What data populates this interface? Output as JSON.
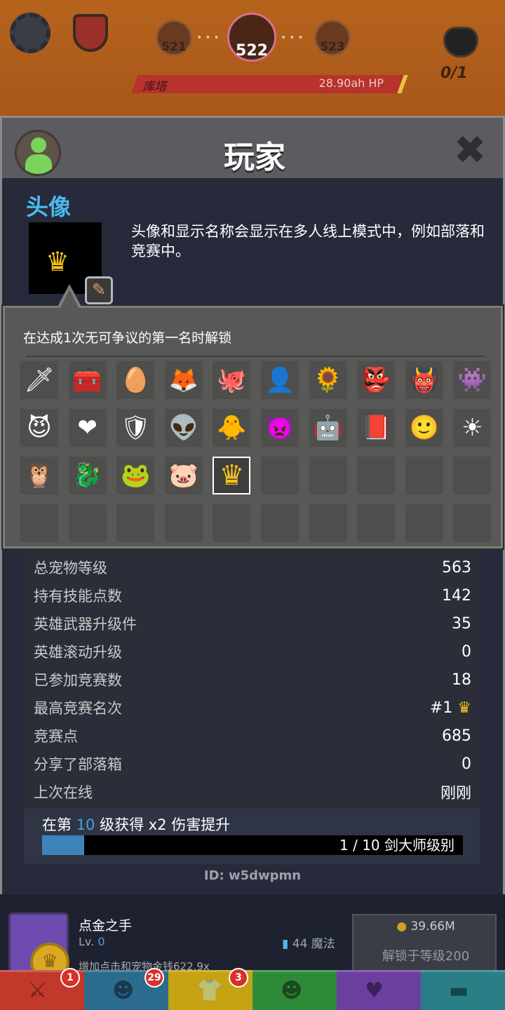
{
  "hud": {
    "stage_prev": "521",
    "stage_current": "522",
    "stage_next": "523",
    "boss_name": "库塔",
    "boss_hp": "28.90ah HP",
    "kills": "0/1"
  },
  "dialog": {
    "title": "玩家",
    "section_label": "头像",
    "description": "头像和显示名称会显示在多人线上模式中，例如部落和竞赛中。",
    "popover_hint": "在达成1次无可争议的第一名时解锁",
    "avatars": [
      {
        "icon": "sword-icon",
        "glyph": "🗡"
      },
      {
        "icon": "treasure-chest-icon",
        "glyph": "🧰"
      },
      {
        "icon": "egg-icon",
        "glyph": "🥚"
      },
      {
        "icon": "fox-icon",
        "glyph": "🦊"
      },
      {
        "icon": "octopus-icon",
        "glyph": "🐙"
      },
      {
        "icon": "blue-spirit-icon",
        "glyph": "👤"
      },
      {
        "icon": "sunflower-icon",
        "glyph": "🌻"
      },
      {
        "icon": "red-mask-icon",
        "glyph": "👺"
      },
      {
        "icon": "red-monster-icon",
        "glyph": "👹"
      },
      {
        "icon": "blue-beast-icon",
        "glyph": "👾"
      },
      {
        "icon": "devil-face-icon",
        "glyph": "😈"
      },
      {
        "icon": "winged-heart-icon",
        "glyph": "❤"
      },
      {
        "icon": "wooden-shield-icon",
        "glyph": "🛡"
      },
      {
        "icon": "green-goblin-icon",
        "glyph": "👽"
      },
      {
        "icon": "chick-icon",
        "glyph": "🐥"
      },
      {
        "icon": "purple-monster-icon",
        "glyph": "👿"
      },
      {
        "icon": "ice-golem-icon",
        "glyph": "🤖"
      },
      {
        "icon": "spellbook-icon",
        "glyph": "📕"
      },
      {
        "icon": "hooded-figure-icon",
        "glyph": "🙂"
      },
      {
        "icon": "red-skull-sun-icon",
        "glyph": "☀"
      },
      {
        "icon": "horned-warrior-icon",
        "glyph": "🦉"
      },
      {
        "icon": "teal-dragon-icon",
        "glyph": "🐉"
      },
      {
        "icon": "green-cat-icon",
        "glyph": "🐸"
      },
      {
        "icon": "pink-fluff-icon",
        "glyph": "🐷"
      },
      {
        "icon": "crown-icon",
        "glyph": "♛"
      }
    ],
    "selected_index": 24,
    "empty_slots": 15
  },
  "stats": [
    {
      "label": "总宠物等级",
      "value": "563"
    },
    {
      "label": "持有技能点数",
      "value": "142"
    },
    {
      "label": "英雄武器升级件",
      "value": "35"
    },
    {
      "label": "英雄滚动升级",
      "value": "0"
    },
    {
      "label": "已参加竞赛数",
      "value": "18"
    },
    {
      "label": "最高竞赛名次",
      "value": "#1"
    },
    {
      "label": "竞赛点",
      "value": "685"
    },
    {
      "label": "分享了部落箱",
      "value": "0"
    },
    {
      "label": "上次在线",
      "value": "刚刚"
    }
  ],
  "progress": {
    "pre": "在第 ",
    "level": "10",
    "post": " 级获得 x2 伤害提升",
    "bar_text": "1 / 10 剑大师级别",
    "fraction": 0.1
  },
  "player_id": "ID: w5dwpmn",
  "background_item": {
    "name": "点金之手",
    "lv_prefix": "Lv. ",
    "lv": "0",
    "mana": "44 魔法",
    "desc": "增加点击和宠物金钱622.9x",
    "cost": "39.66M",
    "unlock": "解锁于等级200"
  },
  "tabs": [
    {
      "name": "tab-sword",
      "badge": "1",
      "color": "#c0392b"
    },
    {
      "name": "tab-heroes",
      "badge": "29",
      "color": "#2b6b8e"
    },
    {
      "name": "tab-equipment",
      "badge": "3",
      "color": "#c5a313"
    },
    {
      "name": "tab-pets",
      "badge": "",
      "color": "#2e8b3a"
    },
    {
      "name": "tab-clan",
      "badge": "",
      "color": "#6b3fa0"
    },
    {
      "name": "tab-shop",
      "badge": "",
      "color": "#2a7f86"
    }
  ]
}
